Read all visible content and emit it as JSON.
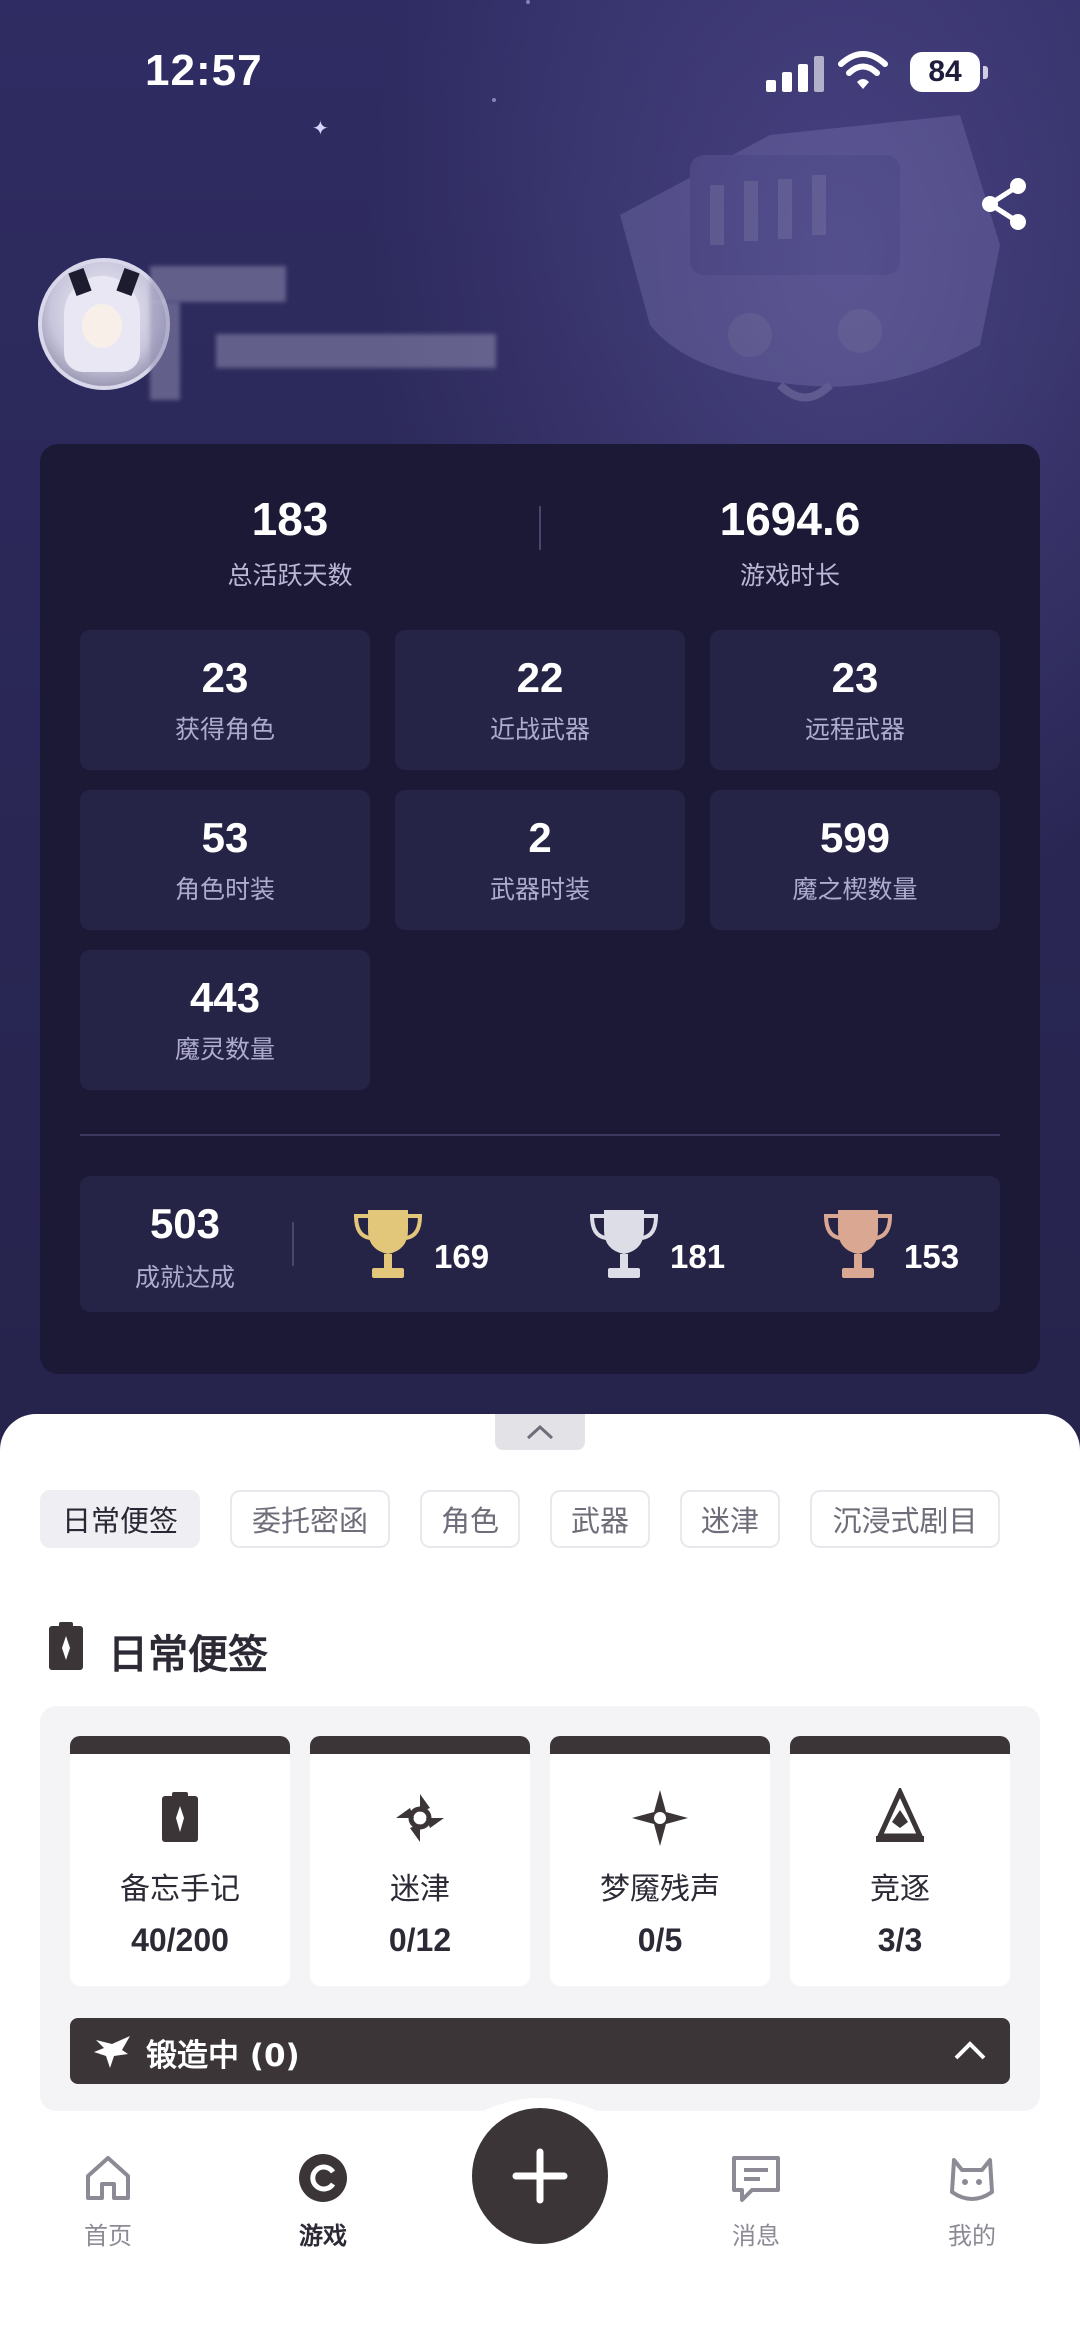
{
  "status_bar": {
    "time": "12:57",
    "battery": "84"
  },
  "stats": {
    "active_days": {
      "value": "183",
      "label": "总活跃天数"
    },
    "play_time": {
      "value": "1694.6",
      "label": "游戏时长"
    },
    "tiles": [
      {
        "value": "23",
        "label": "获得角色"
      },
      {
        "value": "22",
        "label": "近战武器"
      },
      {
        "value": "23",
        "label": "远程武器"
      },
      {
        "value": "53",
        "label": "角色时装"
      },
      {
        "value": "2",
        "label": "武器时装"
      },
      {
        "value": "599",
        "label": "魔之楔数量"
      },
      {
        "value": "443",
        "label": "魔灵数量"
      }
    ],
    "achievements": {
      "value": "503",
      "label": "成就达成",
      "gold": "169",
      "silver": "181",
      "bronze": "153"
    }
  },
  "tabs": [
    "日常便签",
    "委托密函",
    "角色",
    "武器",
    "迷津",
    "沉浸式剧目"
  ],
  "daily_notes": {
    "title": "日常便签",
    "cards": [
      {
        "label": "备忘手记",
        "value": "40/200",
        "icon": "clipboard-icon"
      },
      {
        "label": "迷津",
        "value": "0/12",
        "icon": "vortex-icon"
      },
      {
        "label": "梦魇残声",
        "value": "0/5",
        "icon": "star-eye-icon"
      },
      {
        "label": "竞逐",
        "value": "3/3",
        "icon": "arena-icon"
      }
    ],
    "forge_label": "锻造中 (0)"
  },
  "nav": {
    "home": "首页",
    "games": "游戏",
    "messages": "消息",
    "mine": "我的"
  },
  "colors": {
    "hero_bg": "#2b2858",
    "card_bg": "#1b1936",
    "tile_bg": "#262446",
    "dark_accent": "#3b3538",
    "gold": "#e2c77a",
    "silver": "#dcdde6",
    "bronze": "#d9a792"
  }
}
